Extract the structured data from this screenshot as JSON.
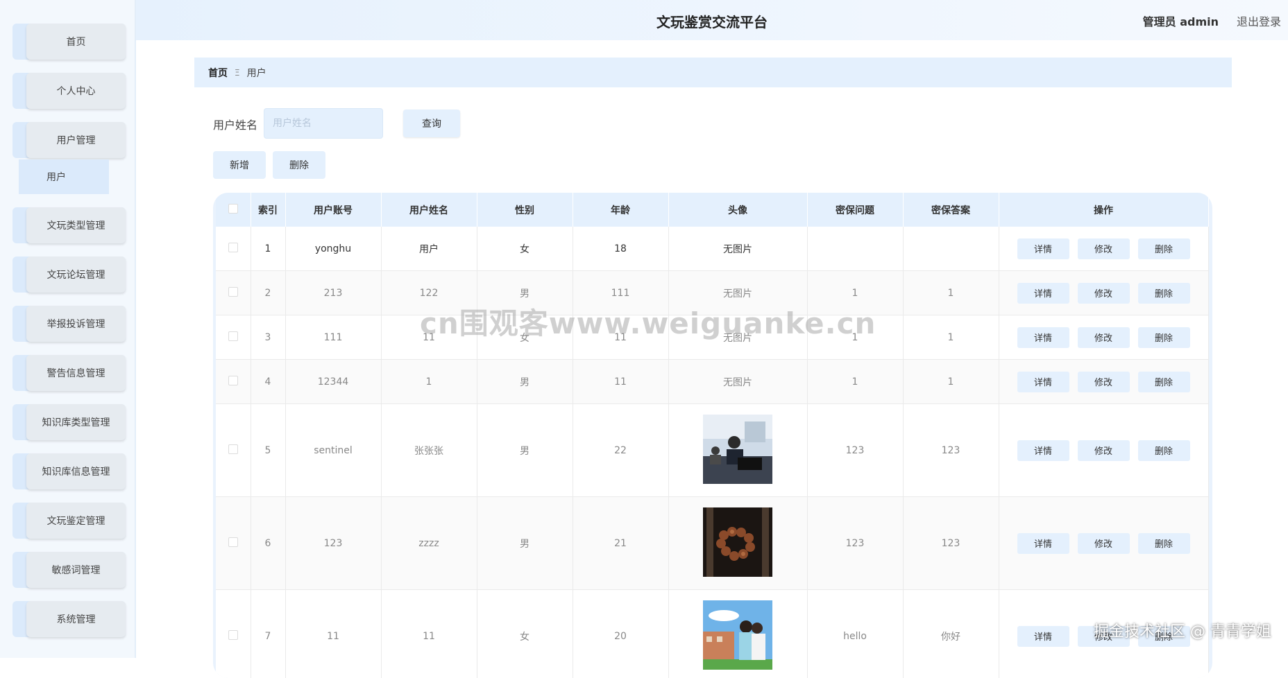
{
  "header": {
    "title": "文玩鉴赏交流平台",
    "user": "管理员 admin",
    "logout": "退出登录"
  },
  "sidebar": {
    "items": [
      {
        "label": "首页"
      },
      {
        "label": "个人中心"
      },
      {
        "label": "用户管理"
      },
      {
        "label": "文玩类型管理"
      },
      {
        "label": "文玩论坛管理"
      },
      {
        "label": "举报投诉管理"
      },
      {
        "label": "警告信息管理"
      },
      {
        "label": "知识库类型管理"
      },
      {
        "label": "知识库信息管理"
      },
      {
        "label": "文玩鉴定管理"
      },
      {
        "label": "敏感词管理"
      },
      {
        "label": "系统管理"
      }
    ],
    "sub_item": "用户"
  },
  "breadcrumb": {
    "home": "首页",
    "separator": "Ξ",
    "current": "用户"
  },
  "search": {
    "label": "用户姓名",
    "placeholder": "用户姓名",
    "query_button": "查询"
  },
  "actions": {
    "add": "新增",
    "delete": "删除"
  },
  "table": {
    "columns": [
      "索引",
      "用户账号",
      "用户姓名",
      "性别",
      "年龄",
      "头像",
      "密保问题",
      "密保答案",
      "操作"
    ],
    "rows": [
      {
        "index": "1",
        "account": "yonghu",
        "name": "用户",
        "gender": "女",
        "age": "18",
        "avatar": "无图片",
        "question": "",
        "answer": ""
      },
      {
        "index": "2",
        "account": "213",
        "name": "122",
        "gender": "男",
        "age": "111",
        "avatar": "无图片",
        "question": "1",
        "answer": "1"
      },
      {
        "index": "3",
        "account": "111",
        "name": "11",
        "gender": "女",
        "age": "11",
        "avatar": "无图片",
        "question": "1",
        "answer": "1"
      },
      {
        "index": "4",
        "account": "12344",
        "name": "1",
        "gender": "男",
        "age": "11",
        "avatar": "无图片",
        "question": "1",
        "answer": "1"
      },
      {
        "index": "5",
        "account": "sentinel",
        "name": "张张张",
        "gender": "男",
        "age": "22",
        "avatar": "office-photo",
        "question": "123",
        "answer": "123"
      },
      {
        "index": "6",
        "account": "123",
        "name": "zzzz",
        "gender": "男",
        "age": "21",
        "avatar": "beads-photo",
        "question": "123",
        "answer": "123"
      },
      {
        "index": "7",
        "account": "11",
        "name": "11",
        "gender": "女",
        "age": "20",
        "avatar": "campus-photo",
        "question": "hello",
        "answer": "你好"
      }
    ],
    "row_actions": {
      "detail": "详情",
      "edit": "修改",
      "delete": "删除"
    }
  },
  "overlay": {
    "watermark": "cn围观客www.weiguanke.cn",
    "credit": "掘金技术社区 @ 青青学姐"
  },
  "colors": {
    "accent": "#e4f0fd",
    "sidebar_bg": "#f3f8fd"
  }
}
